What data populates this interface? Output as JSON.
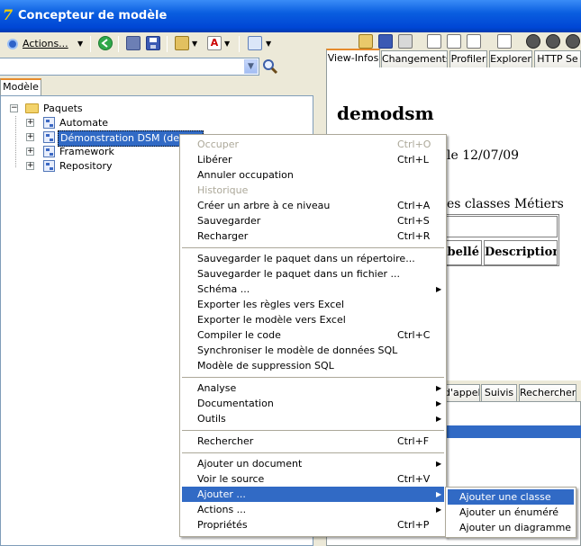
{
  "window": {
    "title": "Concepteur de modèle"
  },
  "toolbar": {
    "actions_label": "Actions..."
  },
  "combo": {
    "value": ""
  },
  "left_tabs": [
    {
      "label": "Modèle"
    }
  ],
  "tree": {
    "root": "Paquets",
    "children": [
      "Automate",
      "Démonstration DSM (demod",
      "Framework",
      "Repository"
    ]
  },
  "right_tabs": [
    {
      "label": "View-Infos"
    },
    {
      "label": "Changements"
    },
    {
      "label": "Profiler"
    },
    {
      "label": "Explorer"
    },
    {
      "label": "HTTP Se"
    }
  ],
  "document": {
    "title": "demodsm",
    "date_line": "le 12/07/09",
    "section_title": "es classes Métiers",
    "col_libelle": "ibellé",
    "col_description": "Description"
  },
  "bottom_tabs": [
    {
      "label": "d'appel"
    },
    {
      "label": "Suivis"
    },
    {
      "label": "Rechercher"
    }
  ],
  "context_menu": {
    "groups": [
      [
        {
          "label": "Occuper",
          "shortcut": "Ctrl+O",
          "disabled": true
        },
        {
          "label": "Libérer",
          "shortcut": "Ctrl+L"
        },
        {
          "label": "Annuler occupation",
          "shortcut": ""
        },
        {
          "label": "Historique",
          "shortcut": "",
          "disabled": true
        },
        {
          "label": "Créer un arbre à ce niveau",
          "shortcut": "Ctrl+A"
        },
        {
          "label": "Sauvegarder",
          "shortcut": "Ctrl+S"
        },
        {
          "label": "Recharger",
          "shortcut": "Ctrl+R"
        }
      ],
      [
        {
          "label": "Sauvegarder le paquet dans un répertoire...",
          "shortcut": ""
        },
        {
          "label": "Sauvegarder le paquet dans un fichier ...",
          "shortcut": ""
        },
        {
          "label": "Schéma ...",
          "shortcut": "",
          "submenu": true
        },
        {
          "label": "Exporter les règles vers Excel",
          "shortcut": ""
        },
        {
          "label": "Exporter le modèle vers Excel",
          "shortcut": ""
        },
        {
          "label": "Compiler le code",
          "shortcut": "Ctrl+C"
        },
        {
          "label": "Synchroniser le modèle de données SQL",
          "shortcut": ""
        },
        {
          "label": "Modèle de suppression SQL",
          "shortcut": ""
        }
      ],
      [
        {
          "label": "Analyse",
          "shortcut": "",
          "submenu": true
        },
        {
          "label": "Documentation",
          "shortcut": "",
          "submenu": true
        },
        {
          "label": "Outils",
          "shortcut": "",
          "submenu": true
        }
      ],
      [
        {
          "label": "Rechercher",
          "shortcut": "Ctrl+F"
        }
      ],
      [
        {
          "label": "Ajouter un document",
          "shortcut": "",
          "submenu": true
        },
        {
          "label": "Voir le source",
          "shortcut": "Ctrl+V"
        },
        {
          "label": "Ajouter ...",
          "shortcut": "",
          "submenu": true,
          "highlighted": true
        },
        {
          "label": "Actions ...",
          "shortcut": "",
          "submenu": true
        },
        {
          "label": "Propriétés",
          "shortcut": "Ctrl+P"
        }
      ]
    ]
  },
  "submenu": {
    "items": [
      {
        "label": "Ajouter une classe",
        "highlighted": true
      },
      {
        "label": "Ajouter un énuméré"
      },
      {
        "label": "Ajouter un diagramme"
      }
    ]
  },
  "colors": {
    "titlebar": "#0a5ee0",
    "selection": "#316ac5",
    "tab_accent": "#e68b2c"
  }
}
